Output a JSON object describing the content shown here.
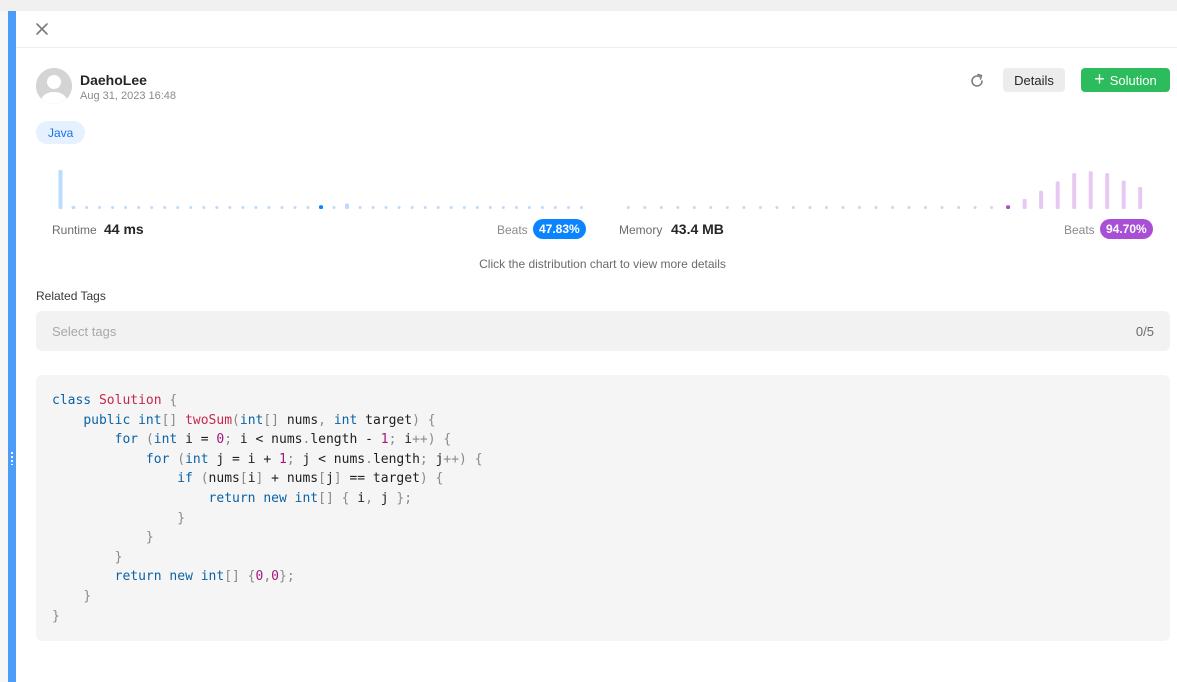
{
  "user": {
    "name": "DaehoLee",
    "date": "Aug 31, 2023 16:48"
  },
  "actions": {
    "details_label": "Details",
    "solution_label": "Solution"
  },
  "language": "Java",
  "runtime": {
    "label": "Runtime",
    "value": "44 ms",
    "beats_label": "Beats",
    "beats_value": "47.83%",
    "color": "#0a84ff",
    "distribution": [
      0.85,
      0.06,
      0.02,
      0.02,
      0.02,
      0.02,
      0.02,
      0.02,
      0.02,
      0.02,
      0.02,
      0.02,
      0.02,
      0.02,
      0.02,
      0.02,
      0.02,
      0.02,
      0.02,
      0.02,
      0.08,
      0.02,
      0.12,
      0.02,
      0.02,
      0.02,
      0.02,
      0.02,
      0.02,
      0.02,
      0.02,
      0.02,
      0.02,
      0.02,
      0.02,
      0.02,
      0.02,
      0.02,
      0.02,
      0.02,
      0.02
    ],
    "highlight_index": 20
  },
  "memory": {
    "label": "Memory",
    "value": "43.4 MB",
    "beats_label": "Beats",
    "beats_value": "94.70%",
    "color": "#a84fd6",
    "distribution": [
      0.02,
      0.02,
      0.02,
      0.02,
      0.02,
      0.02,
      0.02,
      0.02,
      0.02,
      0.02,
      0.02,
      0.02,
      0.02,
      0.02,
      0.02,
      0.02,
      0.02,
      0.02,
      0.02,
      0.02,
      0.02,
      0.02,
      0.02,
      0.08,
      0.22,
      0.4,
      0.6,
      0.78,
      0.82,
      0.78,
      0.62,
      0.48,
      0.25
    ],
    "highlight_index": 23
  },
  "hint": "Click the distribution chart to view more details",
  "tags": {
    "label": "Related Tags",
    "placeholder": "Select tags",
    "count": "0/5"
  },
  "code": [
    [
      [
        "kw",
        "class "
      ],
      [
        "cls",
        "Solution"
      ],
      [
        "pun",
        " {"
      ]
    ],
    [
      [
        "t",
        "    "
      ],
      [
        "kw",
        "public int"
      ],
      [
        "pun",
        "[] "
      ],
      [
        "cls",
        "twoSum"
      ],
      [
        "pun",
        "("
      ],
      [
        "kw",
        "int"
      ],
      [
        "pun",
        "[] "
      ],
      [
        "t",
        "nums"
      ],
      [
        "pun",
        ", "
      ],
      [
        "kw",
        "int "
      ],
      [
        "t",
        "target"
      ],
      [
        "pun",
        ") {"
      ]
    ],
    [
      [
        "t",
        "        "
      ],
      [
        "kw",
        "for "
      ],
      [
        "pun",
        "("
      ],
      [
        "kw",
        "int "
      ],
      [
        "t",
        "i = "
      ],
      [
        "num",
        "0"
      ],
      [
        "pun",
        "; "
      ],
      [
        "t",
        "i < nums"
      ],
      [
        "pun",
        "."
      ],
      [
        "t",
        "length - "
      ],
      [
        "num",
        "1"
      ],
      [
        "pun",
        "; "
      ],
      [
        "t",
        "i"
      ],
      [
        "pun",
        "++) {"
      ]
    ],
    [
      [
        "t",
        "            "
      ],
      [
        "kw",
        "for "
      ],
      [
        "pun",
        "("
      ],
      [
        "kw",
        "int "
      ],
      [
        "t",
        "j = i + "
      ],
      [
        "num",
        "1"
      ],
      [
        "pun",
        "; "
      ],
      [
        "t",
        "j < nums"
      ],
      [
        "pun",
        "."
      ],
      [
        "t",
        "length"
      ],
      [
        "pun",
        "; "
      ],
      [
        "t",
        "j"
      ],
      [
        "pun",
        "++) {"
      ]
    ],
    [
      [
        "t",
        "                "
      ],
      [
        "kw",
        "if "
      ],
      [
        "pun",
        "("
      ],
      [
        "t",
        "nums"
      ],
      [
        "pun",
        "["
      ],
      [
        "t",
        "i"
      ],
      [
        "pun",
        "] "
      ],
      [
        "t",
        "+ nums"
      ],
      [
        "pun",
        "["
      ],
      [
        "t",
        "j"
      ],
      [
        "pun",
        "] "
      ],
      [
        "t",
        "== target"
      ],
      [
        "pun",
        ") {"
      ]
    ],
    [
      [
        "t",
        "                    "
      ],
      [
        "kw",
        "return new int"
      ],
      [
        "pun",
        "[] { "
      ],
      [
        "t",
        "i"
      ],
      [
        "pun",
        ", "
      ],
      [
        "t",
        "j "
      ],
      [
        "pun",
        "};"
      ]
    ],
    [
      [
        "t",
        "                "
      ],
      [
        "pun",
        "}"
      ]
    ],
    [
      [
        "t",
        "            "
      ],
      [
        "pun",
        "}"
      ]
    ],
    [
      [
        "t",
        "        "
      ],
      [
        "pun",
        "}"
      ]
    ],
    [
      [
        "t",
        "        "
      ],
      [
        "kw",
        "return new int"
      ],
      [
        "pun",
        "[] {"
      ],
      [
        "num",
        "0"
      ],
      [
        "pun",
        ","
      ],
      [
        "num",
        "0"
      ],
      [
        "pun",
        "};"
      ]
    ],
    [
      [
        "t",
        "    "
      ],
      [
        "pun",
        "}"
      ]
    ],
    [
      [
        "pun",
        "}"
      ]
    ]
  ]
}
